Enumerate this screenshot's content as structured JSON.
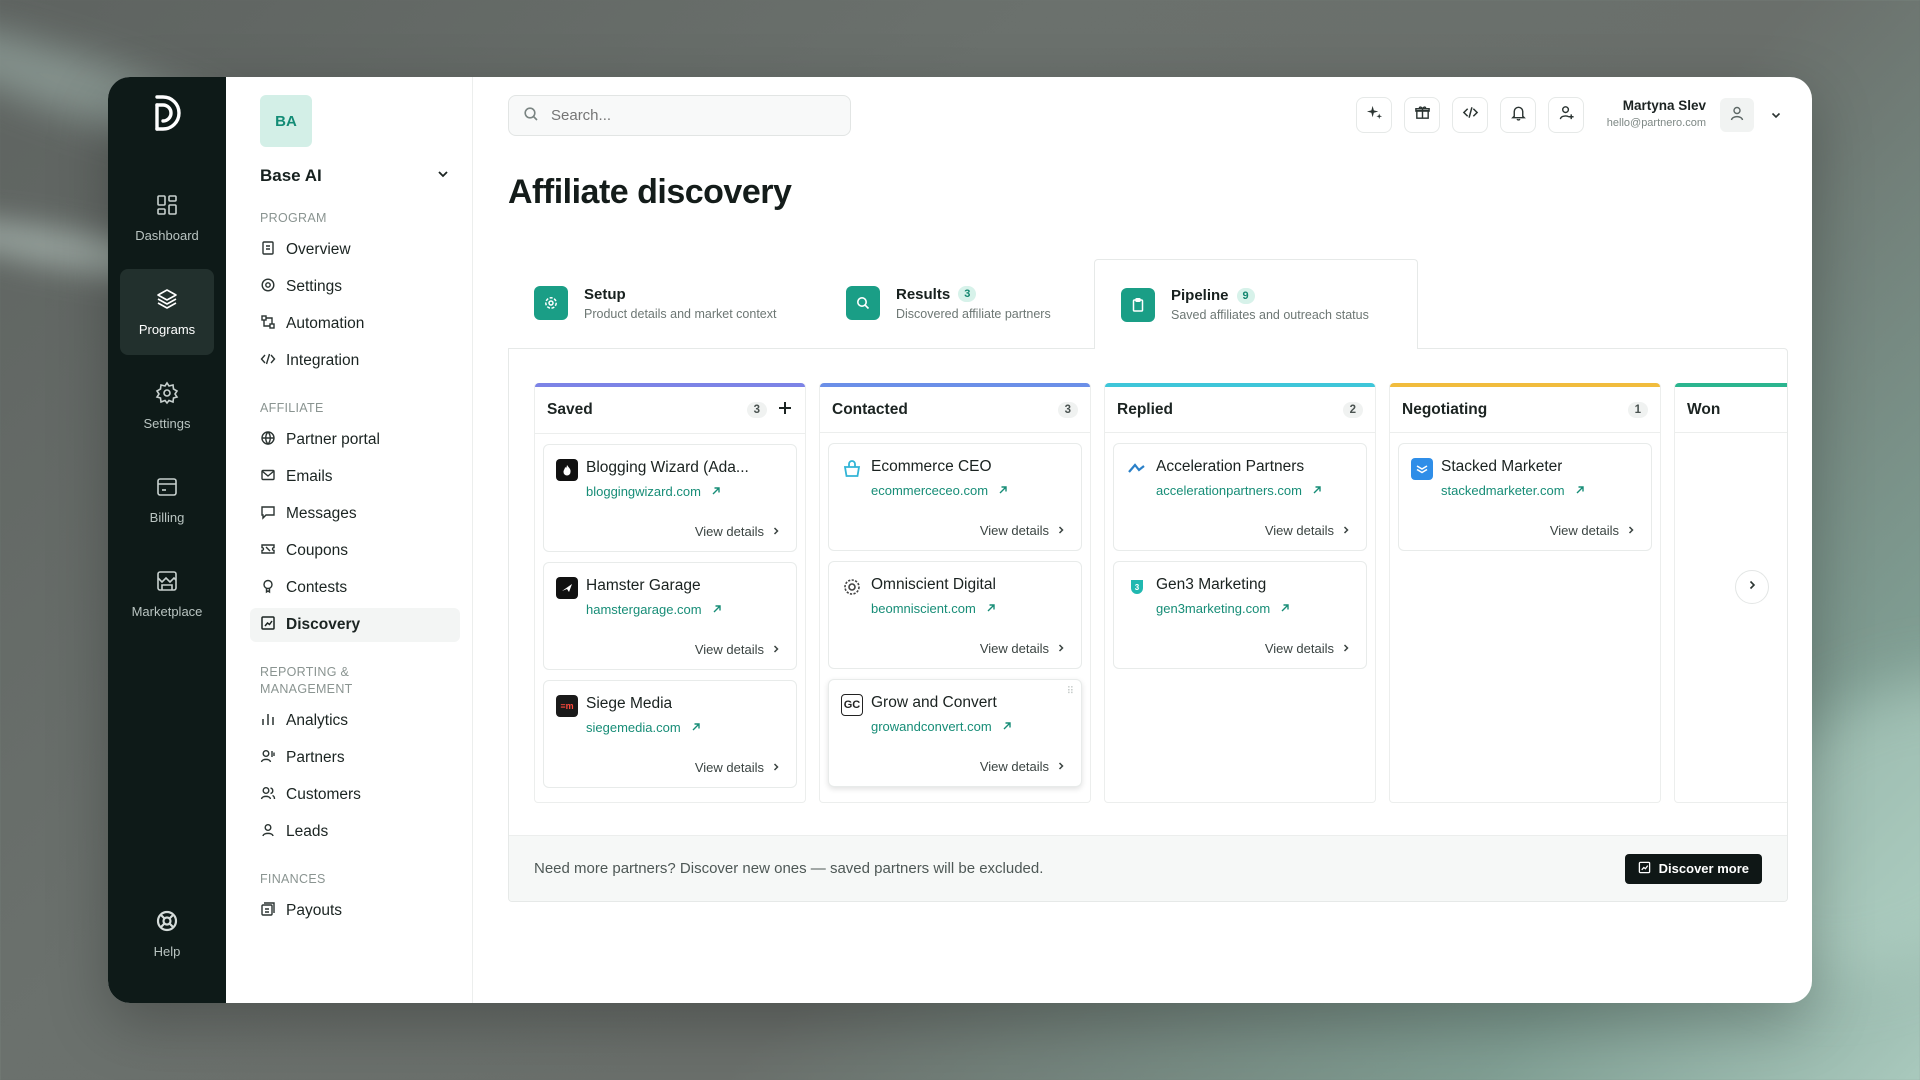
{
  "colors": {
    "accent": "#1a9e86",
    "rail_bg": "#0e1a18",
    "link": "#178d77"
  },
  "rail": {
    "items": [
      {
        "label": "Dashboard",
        "icon": "dashboard-grid-icon"
      },
      {
        "label": "Programs",
        "icon": "layers-icon",
        "active": true
      },
      {
        "label": "Settings",
        "icon": "gear-icon"
      },
      {
        "label": "Billing",
        "icon": "billing-card-icon"
      },
      {
        "label": "Marketplace",
        "icon": "store-icon"
      }
    ],
    "help": "Help"
  },
  "sidebar": {
    "workspace_initials": "BA",
    "workspace_name": "Base AI",
    "program_label": "PROGRAM",
    "program_items": [
      "Overview",
      "Settings",
      "Automation",
      "Integration"
    ],
    "affiliate_label": "AFFILIATE",
    "affiliate_items": [
      "Partner portal",
      "Emails",
      "Messages",
      "Coupons",
      "Contests",
      "Discovery"
    ],
    "reporting_label": "REPORTING & MANAGEMENT",
    "reporting_items": [
      "Analytics",
      "Partners",
      "Customers",
      "Leads"
    ],
    "finances_label": "FINANCES",
    "finances_items": [
      "Payouts"
    ]
  },
  "header": {
    "search_placeholder": "Search...",
    "user_name": "Martyna Slev",
    "user_email": "hello@partnero.com"
  },
  "page": {
    "title": "Affiliate discovery"
  },
  "tabs": [
    {
      "title": "Setup",
      "subtitle": "Product details and market context",
      "count": ""
    },
    {
      "title": "Results",
      "subtitle": "Discovered affiliate partners",
      "count": "3"
    },
    {
      "title": "Pipeline",
      "subtitle": "Saved affiliates and outreach status",
      "count": "9"
    }
  ],
  "board": {
    "view_details": "View details",
    "columns": [
      {
        "title": "Saved",
        "count": "3",
        "color": "#7c83e6",
        "cards": [
          {
            "name": "Blogging Wizard (Ada...",
            "link": "bloggingwizard.com"
          },
          {
            "name": "Hamster Garage",
            "link": "hamstergarage.com"
          },
          {
            "name": "Siege Media",
            "link": "siegemedia.com"
          }
        ]
      },
      {
        "title": "Contacted",
        "count": "3",
        "color": "#6b8fe8",
        "cards": [
          {
            "name": "Ecommerce CEO",
            "link": "ecommerceceo.com"
          },
          {
            "name": "Omniscient Digital",
            "link": "beomniscient.com"
          },
          {
            "name": "Grow and Convert",
            "link": "growandconvert.com"
          }
        ]
      },
      {
        "title": "Replied",
        "count": "2",
        "color": "#3ec6d9",
        "cards": [
          {
            "name": "Acceleration Partners",
            "link": "accelerationpartners.com"
          },
          {
            "name": "Gen3 Marketing",
            "link": "gen3marketing.com"
          }
        ]
      },
      {
        "title": "Negotiating",
        "count": "1",
        "color": "#f1bc3d",
        "cards": [
          {
            "name": "Stacked Marketer",
            "link": "stackedmarketer.com"
          }
        ]
      },
      {
        "title": "Won",
        "count": "",
        "color": "#2bb58f",
        "cards": []
      }
    ],
    "footer_text": "Need more partners? Discover new ones — saved partners will be excluded.",
    "discover_button": "Discover more"
  }
}
